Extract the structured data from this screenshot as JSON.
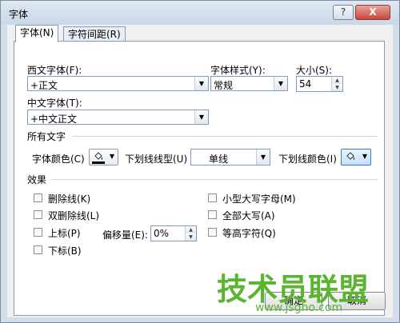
{
  "window": {
    "title": "字体",
    "help_button": "?",
    "close_button": "X"
  },
  "tabs": [
    {
      "label": "字体(N)",
      "active": true
    },
    {
      "label": "字符间距(R)",
      "active": false
    }
  ],
  "latin_font": {
    "label": "西文字体(F):",
    "value": "+正文"
  },
  "font_style": {
    "label": "字体样式(Y):",
    "value": "常规"
  },
  "size": {
    "label": "大小(S):",
    "value": "54"
  },
  "asian_font": {
    "label": "中文字体(T):",
    "value": "+中文正文"
  },
  "all_text": {
    "header": "所有文字",
    "font_color_label": "字体颜色(C)",
    "underline_style_label": "下划线线型(U)",
    "underline_style_value": "单线",
    "underline_color_label": "下划线颜色(I)"
  },
  "effects": {
    "header": "效果",
    "strikethrough": "删除线(K)",
    "double_strikethrough": "双删除线(L)",
    "superscript": "上标(P)",
    "subscript": "下标(B)",
    "offset_label": "偏移量(E):",
    "offset_value": "0%",
    "small_caps": "小型大写字母(M)",
    "all_caps": "全部大写(A)",
    "equalize_height": "等高字符(Q)"
  },
  "buttons": {
    "ok": "确定",
    "cancel": "取消"
  },
  "watermark": {
    "text": "技术员联盟",
    "url": "www.jsgho.com"
  },
  "colors": {
    "title_bar": "#d3dee9",
    "close_button": "#c8473a",
    "watermark": "#5cb531"
  }
}
